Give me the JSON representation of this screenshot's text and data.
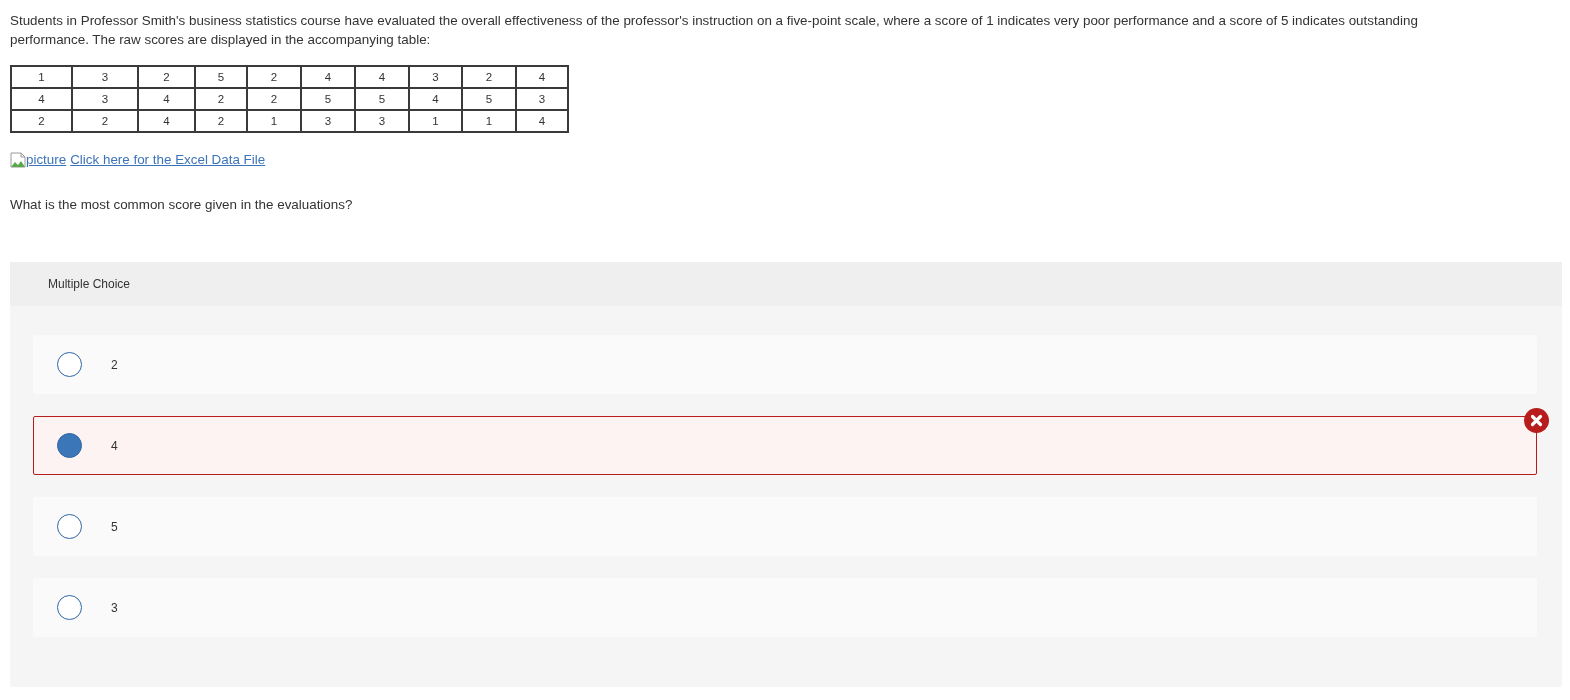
{
  "question": {
    "intro": "Students in Professor Smith's business statistics course have evaluated the overall effectiveness of the professor's instruction on a five-point scale, where a score of 1 indicates very poor performance and a score of 5 indicates outstanding performance. The raw scores are displayed in the accompanying table:",
    "data_table": {
      "rows": [
        [
          "1",
          "3",
          "2",
          "5",
          "2",
          "4",
          "4",
          "3",
          "2",
          "4"
        ],
        [
          "4",
          "3",
          "4",
          "2",
          "2",
          "5",
          "5",
          "4",
          "5",
          "3"
        ],
        [
          "2",
          "2",
          "4",
          "2",
          "1",
          "3",
          "3",
          "1",
          "1",
          "4"
        ]
      ]
    },
    "link": {
      "image_alt": "picture",
      "text": "Click here for the Excel Data File"
    },
    "prompt": "What is the most common score given in the evaluations?"
  },
  "answer_panel": {
    "type_label": "Multiple Choice",
    "options": [
      {
        "label": "2",
        "selected": false,
        "incorrect": false
      },
      {
        "label": "4",
        "selected": true,
        "incorrect": true
      },
      {
        "label": "5",
        "selected": false,
        "incorrect": false
      },
      {
        "label": "3",
        "selected": false,
        "incorrect": false
      }
    ]
  }
}
